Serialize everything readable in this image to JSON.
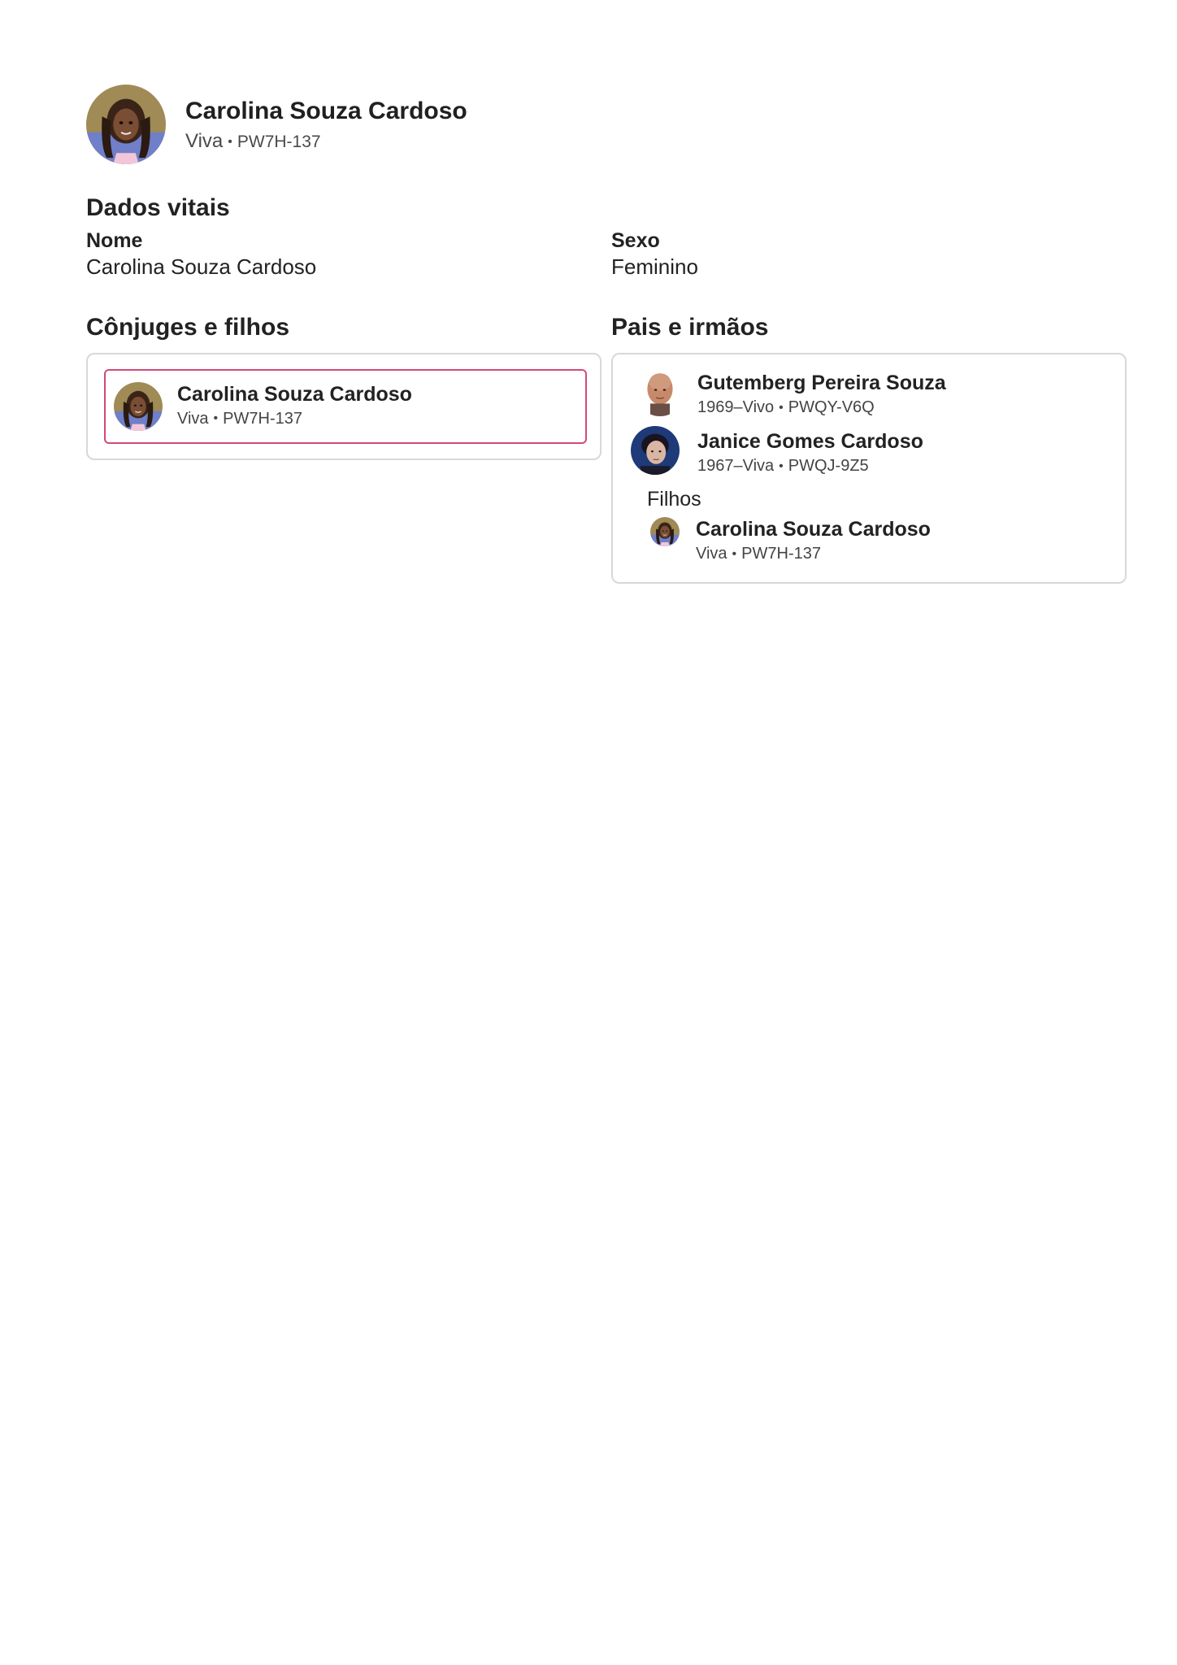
{
  "header": {
    "name": "Carolina Souza Cardoso",
    "status": "Viva",
    "pid": "PW7H-137"
  },
  "vitals": {
    "title": "Dados vitais",
    "name_label": "Nome",
    "name_value": "Carolina Souza Cardoso",
    "sex_label": "Sexo",
    "sex_value": "Feminino"
  },
  "spouses": {
    "title": "Cônjuges e filhos",
    "person": {
      "name": "Carolina Souza Cardoso",
      "status": "Viva",
      "pid": "PW7H-137"
    }
  },
  "parents": {
    "title": "Pais e irmãos",
    "father": {
      "name": "Gutemberg Pereira Souza",
      "dates": "1969–Vivo",
      "pid": "PWQY-V6Q"
    },
    "mother": {
      "name": "Janice Gomes Cardoso",
      "dates": "1967–Viva",
      "pid": "PWQJ-9Z5"
    },
    "children_label": "Filhos",
    "child": {
      "name": "Carolina Souza Cardoso",
      "status": "Viva",
      "pid": "PW7H-137"
    }
  },
  "colors": {
    "highlight_border": "#d04a7c",
    "card_border": "#d8d8d8"
  },
  "icons": [
    "portrait-girl",
    "portrait-man-bald",
    "portrait-young-man"
  ]
}
